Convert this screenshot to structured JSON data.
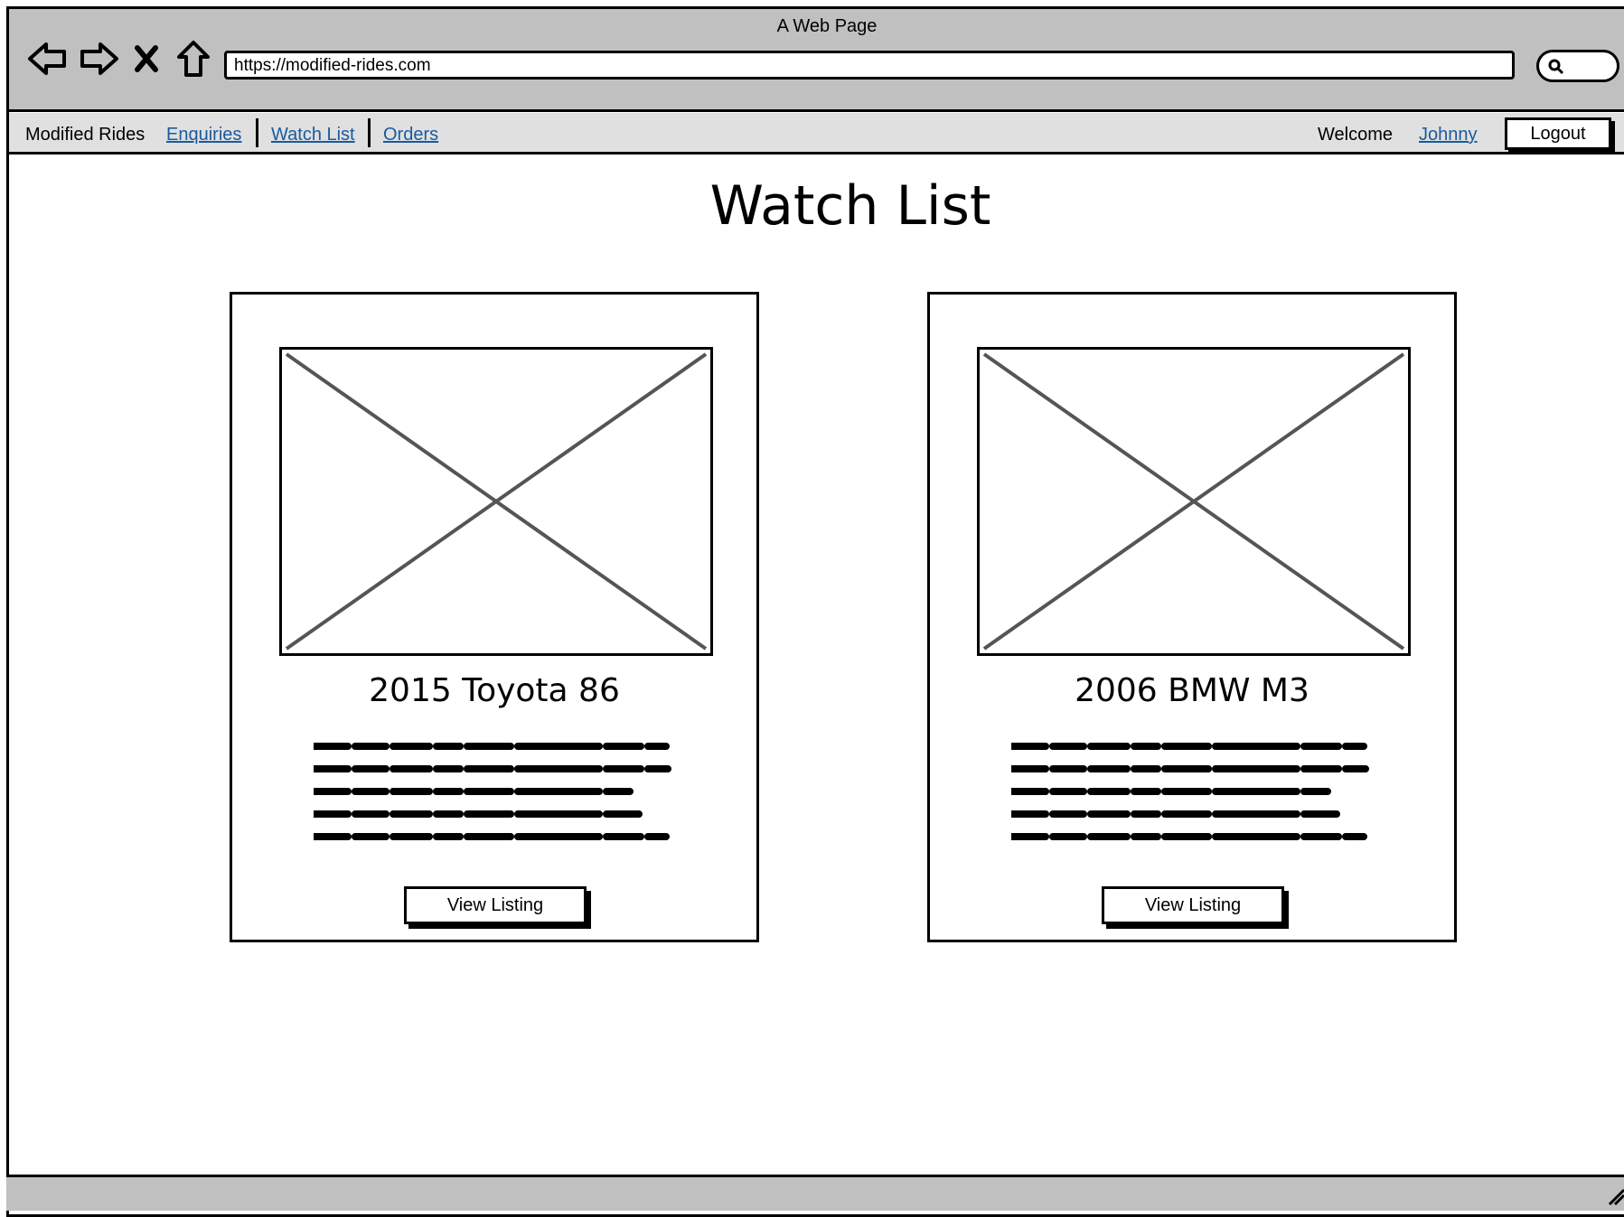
{
  "browser": {
    "window_title": "A Web Page",
    "url": "https://modified-rides.com",
    "nav_icons": [
      "back-arrow-icon",
      "forward-arrow-icon",
      "stop-icon",
      "home-icon"
    ]
  },
  "nav": {
    "brand": "Modified Rides",
    "links": [
      "Enquiries",
      "Watch List",
      "Orders"
    ],
    "welcome": "Welcome",
    "user": "Johnny",
    "logout": "Logout"
  },
  "page": {
    "title": "Watch List"
  },
  "cards": [
    {
      "title": "2015 Toyota 86",
      "button": "View Listing"
    },
    {
      "title": "2006 BMW M3",
      "button": "View Listing"
    }
  ],
  "colors": {
    "chrome_bg": "#c0c0c0",
    "appbar_bg": "#e0e0e0",
    "link": "#1a5a9e"
  }
}
